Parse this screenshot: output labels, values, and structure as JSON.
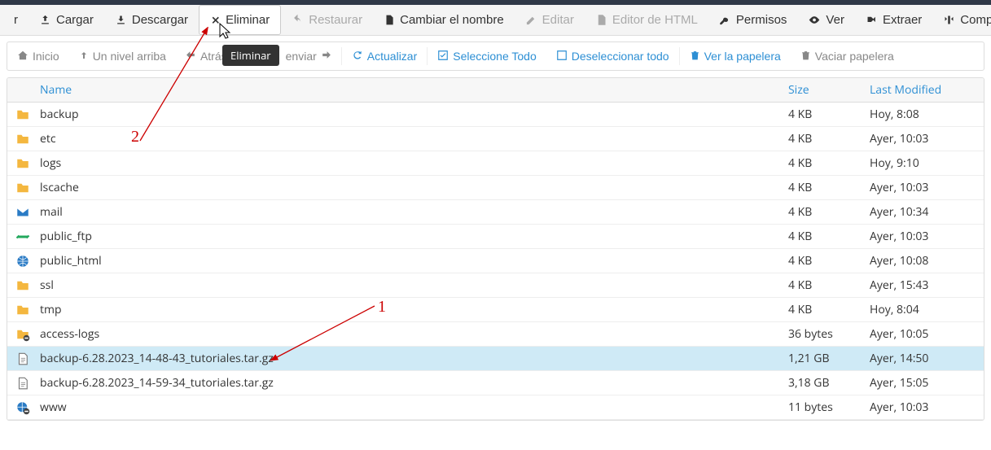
{
  "toolbar": {
    "cargar_suffix": "r",
    "cargar": "Cargar",
    "descargar": "Descargar",
    "eliminar": "Eliminar",
    "restaurar": "Restaurar",
    "cambiar": "Cambiar el nombre",
    "editar": "Editar",
    "editor_html": "Editor de HTML",
    "permisos": "Permisos",
    "ver": "Ver",
    "extraer": "Extraer",
    "comprimir": "Comprimir"
  },
  "sec_toolbar": {
    "inicio": "Inicio",
    "nivel_arriba": "Un nivel arriba",
    "atras": "Atrás",
    "enviar": "enviar",
    "actualizar": "Actualizar",
    "seleccionar_todo": "Seleccione Todo",
    "deseleccionar_todo": "Deseleccionar todo",
    "ver_papelera": "Ver la papelera",
    "vaciar_papelera": "Vaciar papelera"
  },
  "tooltip": "Eliminar",
  "table": {
    "headers": {
      "name": "Name",
      "size": "Size",
      "modified": "Last Modified"
    },
    "rows": [
      {
        "icon": "folder",
        "name": "backup",
        "size": "4 KB",
        "modified": "Hoy, 8:08",
        "selected": false
      },
      {
        "icon": "folder",
        "name": "etc",
        "size": "4 KB",
        "modified": "Ayer, 10:03",
        "selected": false
      },
      {
        "icon": "folder",
        "name": "logs",
        "size": "4 KB",
        "modified": "Hoy, 9:10",
        "selected": false
      },
      {
        "icon": "folder",
        "name": "lscache",
        "size": "4 KB",
        "modified": "Ayer, 10:03",
        "selected": false
      },
      {
        "icon": "mail",
        "name": "mail",
        "size": "4 KB",
        "modified": "Ayer, 10:34",
        "selected": false
      },
      {
        "icon": "link",
        "name": "public_ftp",
        "size": "4 KB",
        "modified": "Ayer, 10:03",
        "selected": false
      },
      {
        "icon": "globe",
        "name": "public_html",
        "size": "4 KB",
        "modified": "Ayer, 10:08",
        "selected": false
      },
      {
        "icon": "folder",
        "name": "ssl",
        "size": "4 KB",
        "modified": "Ayer, 15:43",
        "selected": false
      },
      {
        "icon": "folder",
        "name": "tmp",
        "size": "4 KB",
        "modified": "Hoy, 8:04",
        "selected": false
      },
      {
        "icon": "linkfold",
        "name": "access-logs",
        "size": "36 bytes",
        "modified": "Ayer, 10:05",
        "selected": false
      },
      {
        "icon": "file",
        "name": "backup-6.28.2023_14-48-43_tutoriales.tar.gz",
        "size": "1,21 GB",
        "modified": "Ayer, 14:50",
        "selected": true
      },
      {
        "icon": "file",
        "name": "backup-6.28.2023_14-59-34_tutoriales.tar.gz",
        "size": "3,18 GB",
        "modified": "Ayer, 15:05",
        "selected": false
      },
      {
        "icon": "globelk",
        "name": "www",
        "size": "11 bytes",
        "modified": "Ayer, 10:03",
        "selected": false
      }
    ]
  },
  "annotations": {
    "one": "1",
    "two": "2"
  }
}
